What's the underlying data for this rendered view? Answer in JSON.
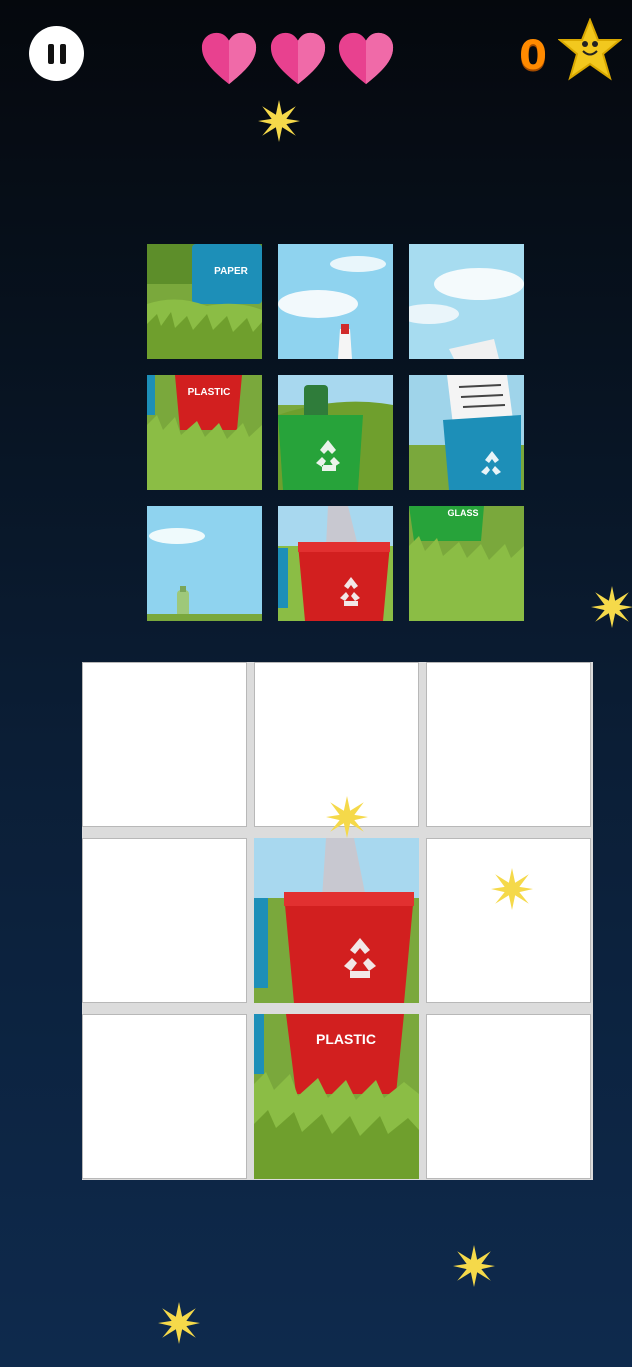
{
  "hud": {
    "score": "0",
    "lives": 3,
    "icons": [
      "pause-icon",
      "heart-icon",
      "starfish-icon",
      "sparkle-icon"
    ]
  },
  "tiles": [
    {
      "id": 1,
      "label": "PAPER",
      "content": "blue-bin-top"
    },
    {
      "id": 2,
      "label": "",
      "content": "sky-bottle-cap"
    },
    {
      "id": 3,
      "label": "",
      "content": "sky-paper-top"
    },
    {
      "id": 4,
      "label": "PLASTIC",
      "content": "red-bin-bottom-left"
    },
    {
      "id": 5,
      "label": "",
      "content": "green-bin-bottle"
    },
    {
      "id": 6,
      "label": "",
      "content": "blue-bin-papers"
    },
    {
      "id": 7,
      "label": "",
      "content": "sky-bottle-neck"
    },
    {
      "id": 8,
      "label": "",
      "content": "red-bin-top"
    },
    {
      "id": 9,
      "label": "GLASS",
      "content": "green-bin-bottom"
    }
  ],
  "board": {
    "rows": 3,
    "cols": 3,
    "placed": [
      {
        "cell": 4,
        "content": "red-bin-top"
      },
      {
        "cell": 7,
        "label": "PLASTIC",
        "content": "red-bin-bottom"
      }
    ]
  },
  "colors": {
    "heart": "#e8418f",
    "score": "#ff8a00",
    "sparkle": "#f5d94a",
    "red_bin": "#d21f1f",
    "green_bin": "#27a33a",
    "blue_bin": "#1d8fb8",
    "grass": "#6aa032",
    "sky": "#8fd3ef"
  }
}
